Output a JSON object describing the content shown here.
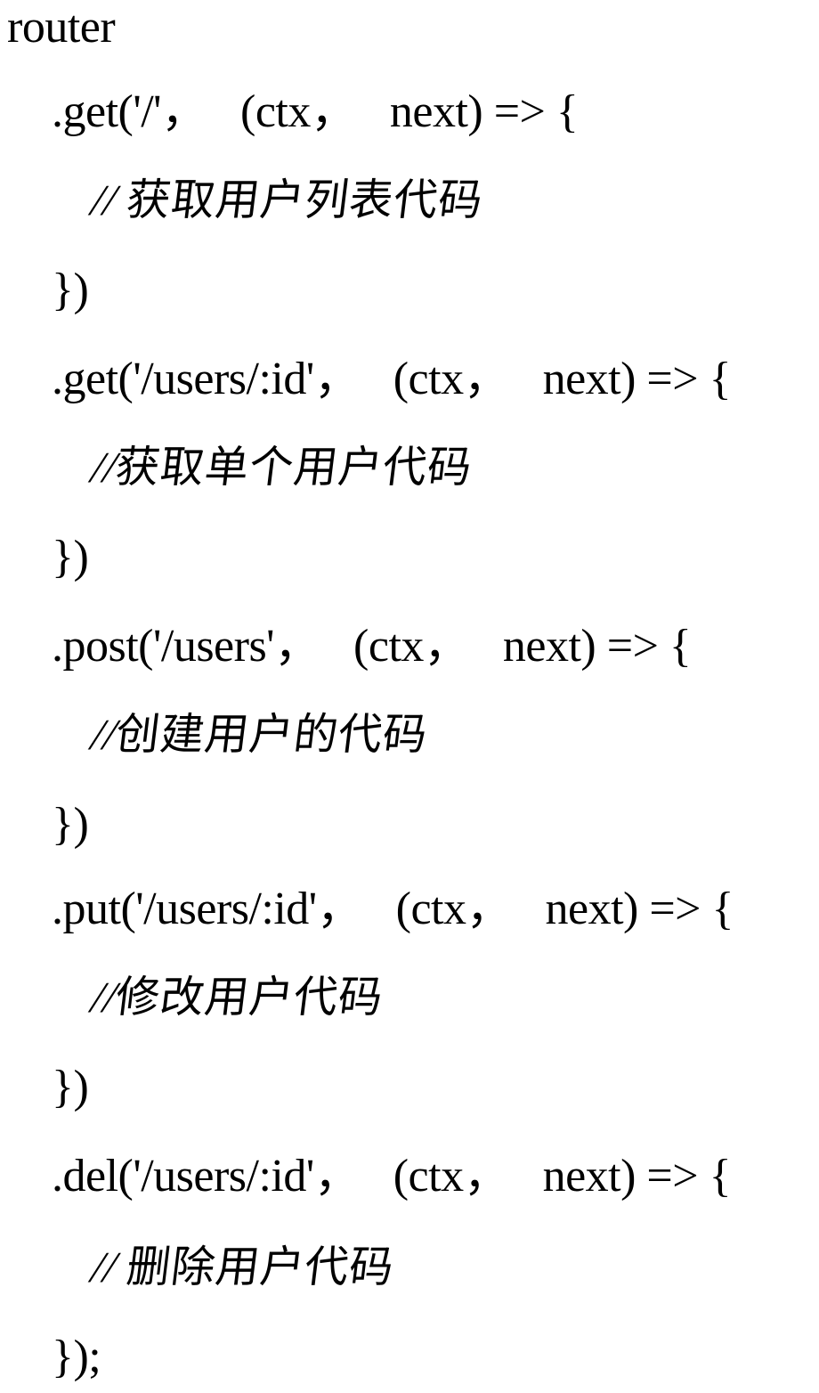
{
  "document": {
    "kind": "code-snippet",
    "language": "javascript",
    "background_color": "#ffffff",
    "text_color": "#000000"
  },
  "code": {
    "lines": [
      {
        "id": "line-router",
        "text": "router",
        "type": "code",
        "indent": "none"
      },
      {
        "id": "line-get-root",
        "text": ".get('/'，   (ctx，   next) => {",
        "type": "code",
        "indent": "level-1"
      },
      {
        "id": "comment-get-list",
        "slashes": "// ",
        "cjk": "获取用户列表代码",
        "text": "// 获取用户列表代码",
        "type": "comment",
        "indent": "level-2"
      },
      {
        "id": "line-close-1",
        "text": "})",
        "type": "code",
        "indent": "level-1"
      },
      {
        "id": "line-get-id",
        "text": ".get('/users/:id'，   (ctx，   next) => {",
        "type": "code",
        "indent": "level-1"
      },
      {
        "id": "comment-get-single",
        "slashes": "//",
        "cjk": "获取单个用户代码",
        "text": "//获取单个用户代码",
        "type": "comment",
        "indent": "level-2"
      },
      {
        "id": "line-close-2",
        "text": "})",
        "type": "code",
        "indent": "level-1"
      },
      {
        "id": "line-post-users",
        "text": ".post('/users'，   (ctx，   next) => {",
        "type": "code",
        "indent": "level-1"
      },
      {
        "id": "comment-create",
        "slashes": "//",
        "cjk": "创建用户的代码",
        "text": "//创建用户的代码",
        "type": "comment",
        "indent": "level-2"
      },
      {
        "id": "line-close-3",
        "text": "})",
        "type": "code",
        "indent": "level-1"
      },
      {
        "id": "line-put-id",
        "text": ".put('/users/:id'，   (ctx，   next) => {",
        "type": "code",
        "indent": "level-1"
      },
      {
        "id": "comment-update",
        "slashes": "//",
        "cjk": "修改用户代码",
        "text": "//修改用户代码",
        "type": "comment",
        "indent": "level-2"
      },
      {
        "id": "line-close-4",
        "text": "})",
        "type": "code",
        "indent": "level-1"
      },
      {
        "id": "line-del-id",
        "text": ".del('/users/:id'，   (ctx，   next) => {",
        "type": "code",
        "indent": "level-1"
      },
      {
        "id": "comment-delete",
        "slashes": "// ",
        "cjk": "删除用户代码",
        "text": "// 删除用户代码",
        "type": "comment",
        "indent": "level-2"
      },
      {
        "id": "line-close-final",
        "text": "});",
        "type": "code",
        "indent": "level-1"
      }
    ]
  }
}
